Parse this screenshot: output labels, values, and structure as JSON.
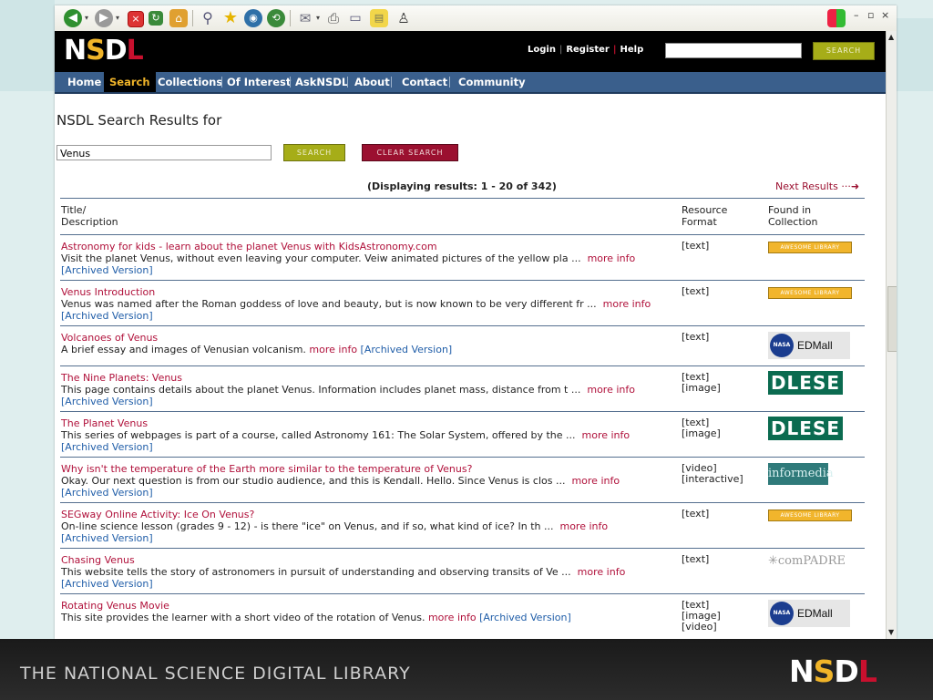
{
  "colors": {
    "accent_gold": "#f0b429",
    "accent_red": "#c8102e",
    "nav_blue": "#3a5f8c",
    "link_red": "#b0103a",
    "link_blue": "#1f5da8"
  },
  "toolbar": {
    "icons": [
      "back-icon",
      "forward-icon",
      "stop-icon",
      "refresh-icon",
      "home-icon",
      "search-icon",
      "favorites-icon",
      "media-icon",
      "history-icon",
      "mail-icon",
      "print-icon",
      "edit-icon",
      "discuss-icon",
      "messenger-icon"
    ]
  },
  "header": {
    "logo": {
      "n": "N",
      "s": "S",
      "d": "D",
      "l": "L"
    },
    "login": "Login",
    "register": "Register",
    "help": "Help",
    "search_button": "SEARCH"
  },
  "nav": [
    "Home",
    "Search",
    "Collections",
    "Of Interest",
    "AskNSDL",
    "About",
    "Contact",
    "Community"
  ],
  "page": {
    "title": "NSDL Search Results for",
    "query": "Venus",
    "search_button": "SEARCH",
    "clear_button": "CLEAR SEARCH",
    "displaying": "(Displaying results: 1 - 20 of 342)",
    "next_results": "Next Results",
    "next_arrow": "···➜"
  },
  "table": {
    "col_title": "Title/\nDescription",
    "col_title_1": "Title/",
    "col_title_2": "Description",
    "col_format_1": "Resource",
    "col_format_2": "Format",
    "col_collection_1": "Found in",
    "col_collection_2": "Collection",
    "more_info": "more info",
    "archived": "[Archived Version]",
    "rows": [
      {
        "title": "Astronomy for kids - learn about the planet Venus with KidsAstronomy.com",
        "desc": "Visit the planet Venus, without even leaving your computer. Veiw animated pictures of the yellow pla ...",
        "format": "[text]",
        "collection": "AWESOME LIBRARY"
      },
      {
        "title": "Venus Introduction",
        "desc": "Venus was named after the Roman goddess of love and beauty, but is now known to be very different fr ...",
        "format": "[text]",
        "collection": "AWESOME LIBRARY"
      },
      {
        "title": "Volcanoes of Venus",
        "desc": "A brief essay and images of Venusian volcanism.",
        "format": "[text]",
        "collection": "EDMall"
      },
      {
        "title": "The Nine Planets: Venus",
        "desc": "This page contains details about the planet Venus. Information includes planet mass, distance from t ...",
        "format": "[text]\n[image]",
        "collection": "DLESE"
      },
      {
        "title": "The Planet Venus",
        "desc": "This series of webpages is part of a course, called Astronomy 161: The Solar System, offered by the ...",
        "format": "[text]\n[image]",
        "collection": "DLESE"
      },
      {
        "title": "Why isn't the temperature of the Earth more similar to the temperature of Venus?",
        "desc": "Okay. Our next question is from our studio audience, and this is Kendall. Hello. Since Venus is clos ...",
        "format": "[video]\n[interactive]",
        "collection": "informedia"
      },
      {
        "title": "SEGway Online Activity: Ice On Venus?",
        "desc": "On-line science lesson (grades 9 - 12) - is there \"ice\" on Venus, and if so, what kind of ice? In th ...",
        "format": "[text]",
        "collection": "AWESOME LIBRARY"
      },
      {
        "title": "Chasing Venus",
        "desc": "This website tells the story of astronomers in pursuit of understanding and observing transits of Ve ...",
        "format": "[text]",
        "collection": "comPADRE"
      },
      {
        "title": "Rotating Venus Movie",
        "desc": "This site provides the learner with a short video of the rotation of Venus.",
        "format": "[text]\n[image]\n[video]",
        "collection": "EDMall"
      }
    ]
  },
  "badges": {
    "nasa": "NASA"
  },
  "footer": {
    "text": "THE NATIONAL SCIENCE DIGITAL LIBRARY"
  }
}
